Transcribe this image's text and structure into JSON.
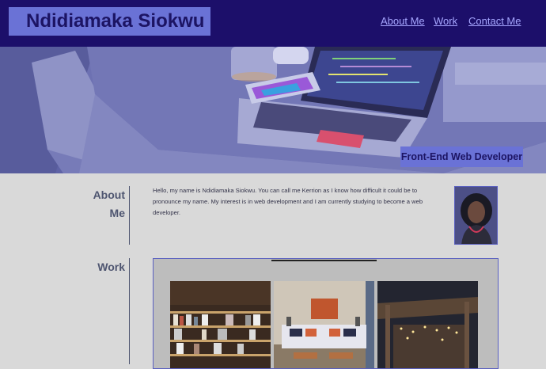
{
  "header": {
    "brand": "Ndidiamaka Siokwu",
    "nav": [
      "About Me",
      "Work",
      "Contact Me"
    ]
  },
  "hero": {
    "tagline": "Front-End Web Developer"
  },
  "about": {
    "heading_line1": "About",
    "heading_line2": "Me",
    "text": "Hello, my name is Ndidiamaka Siokwu. You can call me Kerrion as I know how difficult it could be to pronounce my name. My interest is in web development and I am currently studying to become a web developer."
  },
  "work": {
    "heading": "Work"
  },
  "colors": {
    "header_bg": "#1c0f6a",
    "accent": "#6a72d6",
    "page_bg": "#d9d9d9",
    "link": "#a6a6ff"
  },
  "icons": {
    "brand": "name-logo-block"
  }
}
